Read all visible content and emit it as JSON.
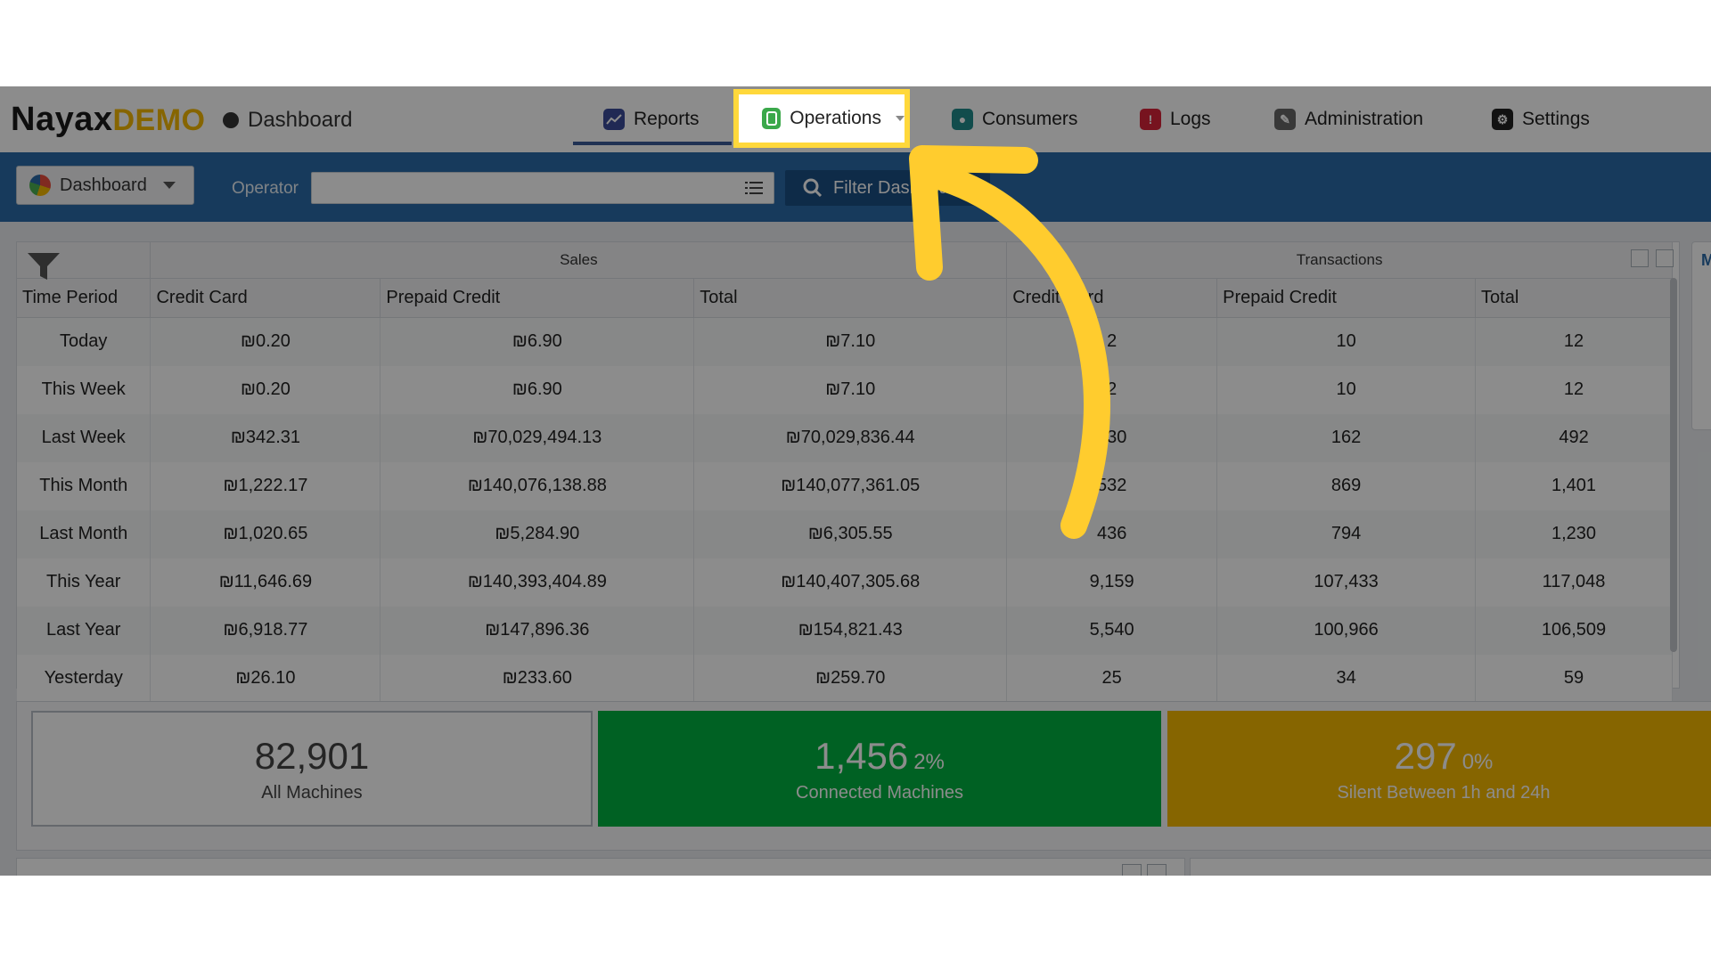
{
  "brand": {
    "name": "Nayax",
    "badge": "DEMO"
  },
  "breadcrumb": "Dashboard",
  "nav": {
    "reports": "Reports",
    "operations": "Operations",
    "consumers": "Consumers",
    "logs": "Logs",
    "administration": "Administration",
    "settings": "Settings"
  },
  "toolbar": {
    "dashboard_select": "Dashboard",
    "operator_label": "Operator",
    "operator_value": "",
    "filter_button": "Filter Dashboard"
  },
  "table": {
    "group_headers": {
      "sales": "Sales",
      "transactions": "Transactions"
    },
    "columns": [
      "Time Period",
      "Credit Card",
      "Prepaid Credit",
      "Total",
      "Credit Card",
      "Prepaid Credit",
      "Total"
    ],
    "rows": [
      [
        "Today",
        "₪0.20",
        "₪6.90",
        "₪7.10",
        "2",
        "10",
        "12"
      ],
      [
        "This Week",
        "₪0.20",
        "₪6.90",
        "₪7.10",
        "2",
        "10",
        "12"
      ],
      [
        "Last Week",
        "₪342.31",
        "₪70,029,494.13",
        "₪70,029,836.44",
        "330",
        "162",
        "492"
      ],
      [
        "This Month",
        "₪1,222.17",
        "₪140,076,138.88",
        "₪140,077,361.05",
        "532",
        "869",
        "1,401"
      ],
      [
        "Last Month",
        "₪1,020.65",
        "₪5,284.90",
        "₪6,305.55",
        "436",
        "794",
        "1,230"
      ],
      [
        "This Year",
        "₪11,646.69",
        "₪140,393,404.89",
        "₪140,407,305.68",
        "9,159",
        "107,433",
        "117,048"
      ],
      [
        "Last Year",
        "₪6,918.77",
        "₪147,896.36",
        "₪154,821.43",
        "5,540",
        "100,966",
        "106,509"
      ],
      [
        "Yesterday",
        "₪26.10",
        "₪233.60",
        "₪259.70",
        "25",
        "34",
        "59"
      ]
    ]
  },
  "side_stub_label": "M",
  "cards": [
    {
      "value": "82,901",
      "pct": "",
      "label": "All Machines"
    },
    {
      "value": "1,456",
      "pct": "2%",
      "label": "Connected Machines"
    },
    {
      "value": "297",
      "pct": "0%",
      "label": "Silent Between 1h and 24h"
    }
  ],
  "colors": {
    "primary": "#2a6ba8",
    "connected": "#00b140",
    "silent": "#f5b800",
    "highlight": "#ffd83b"
  },
  "icons": [
    "reports-icon",
    "operations-icon",
    "consumers-icon",
    "logs-icon",
    "administration-icon",
    "settings-icon",
    "search-icon",
    "list-icon",
    "funnel-icon",
    "arrow-annotation"
  ]
}
